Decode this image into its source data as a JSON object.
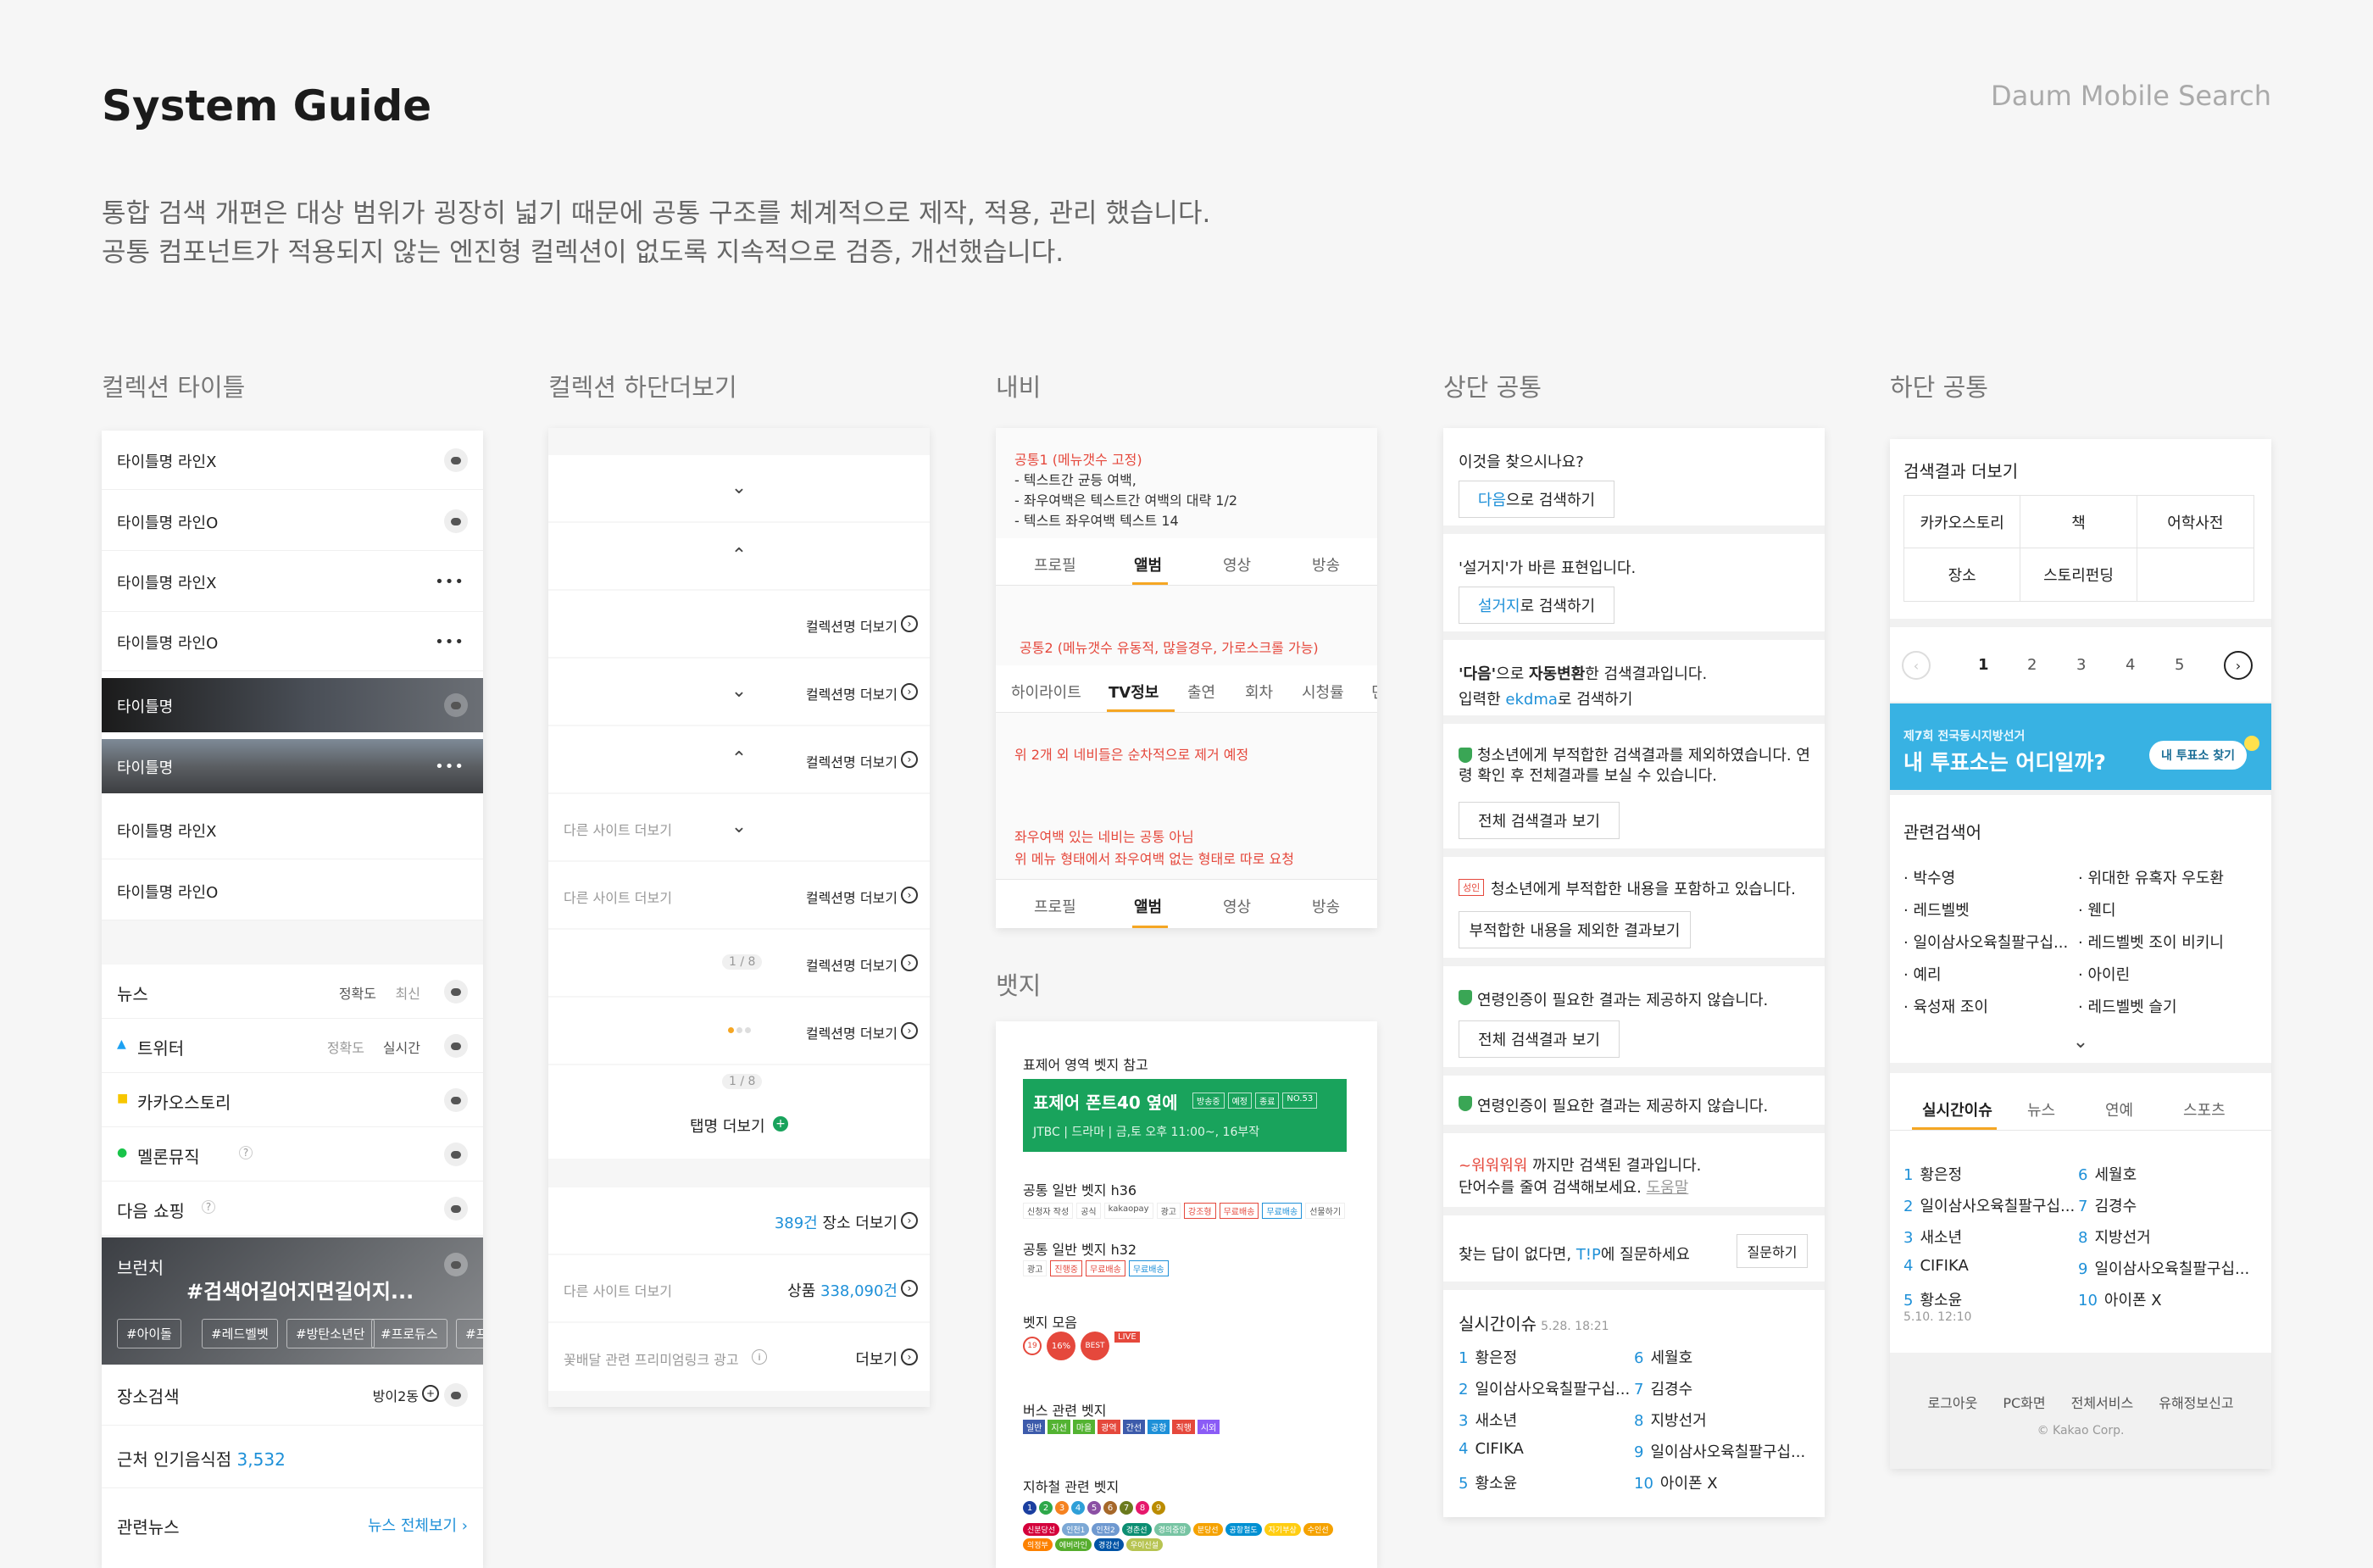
{
  "header": {
    "title": "System Guide",
    "brand": "Daum Mobile Search",
    "intro_line1": "통합 검색 개편은 대상 범위가 굉장히 넓기 때문에 공통 구조를 체계적으로 제작, 적용, 관리 했습니다.",
    "intro_line2": "공통 컴포넌트가 적용되지 않는 엔진형 컬렉션이 없도록 지속적으로 검증, 개선했습니다."
  },
  "columns": {
    "col1": "컬렉션 타이틀",
    "col2": "컬렉션 하단더보기",
    "col3": "내비",
    "col3b": "뱃지",
    "col4": "상단 공통",
    "col5": "하단 공통"
  },
  "col1": {
    "rows": [
      "타이틀명 라인X",
      "타이틀명 라인O",
      "타이틀명 라인X",
      "타이틀명 라인O",
      "타이틀명",
      "타이틀명",
      "타이틀명 라인X",
      "타이틀명 라인O"
    ],
    "news": "뉴스",
    "sort1": "정확도",
    "sort2": "최신",
    "twitter": "트위터",
    "tw_sort1": "정확도",
    "tw_sort2": "실시간",
    "kakaostory": "카카오스토리",
    "melon": "멜론뮤직",
    "melon_help": "?",
    "shopping": "다음 쇼핑",
    "shopping_help": "?",
    "brunch": "브런치",
    "brunch_headline": "#검색어길어지면길어지...",
    "tags": [
      "#아이돌",
      "#레드벨벳",
      "#방탄소년단",
      "#프로듀스",
      "#프"
    ],
    "place": "장소검색",
    "place_loc": "방이2동",
    "food_label": "근처 인기음식점",
    "food_count": "3,532",
    "related_news": "관련뉴스",
    "news_all": "뉴스 전체보기"
  },
  "col2": {
    "more": "컬렉션명 더보기",
    "other_site": "다른 사이트 더보기",
    "page1": "1 / 8",
    "page2": "1 / 8",
    "tab_more": "탭명 더보기",
    "place_count": "389건",
    "place_more": "장소 더보기",
    "prod_label": "상품",
    "prod_count": "338,090건",
    "ad": "꽃배달 관련 프리미엄링크 광고",
    "ad_more": "더보기"
  },
  "col3": {
    "note1_title": "공통1 (메뉴갯수 고정)",
    "note1_l1": "- 텍스트간 균등 여백,",
    "note1_l2": "- 좌우여백은 텍스트간 여백의 대략 1/2",
    "note1_l3": "- 텍스트 좌우여백 텍스트 14",
    "tabs1": [
      "프로필",
      "앨범",
      "영상",
      "방송"
    ],
    "note2": "공통2 (메뉴갯수 유동적, 많을경우, 가로스크롤 가능)",
    "tabs2": [
      "하이라이트",
      "TV정보",
      "출연",
      "회차",
      "시청률",
      "던"
    ],
    "note3": "위 2개 외 네비들은 순차적으로 제거 예정",
    "note4_l1": "좌우여백 있는 네비는 공통 아님",
    "note4_l2": "위 메뉴 형태에서 좌우여백 없는 형태로 따로 요청",
    "tabs3": [
      "프로필",
      "앨범",
      "영상",
      "방송"
    ]
  },
  "badges": {
    "ref": "표제어 영역 벳지 참고",
    "head_title": "표제어 폰트40 옆에",
    "head_badges": [
      "방송중",
      "예정",
      "종료",
      "NO.53"
    ],
    "head_sub": "JTBC  |  드라마  |  금,토 오후 11:00~, 16부작",
    "h36": "공통 일반 벳지 h36",
    "h36_pills": [
      "신청자 작성",
      "공식",
      "kakaopay",
      "광고",
      "강조형",
      "무료배송",
      "무료배송",
      "선물하기"
    ],
    "h32": "공통 일반 벳지 h32",
    "h32_pills": [
      "광고",
      "진행중",
      "무료배송",
      "무료배송"
    ],
    "collection": "벳지 모음",
    "col_pills": [
      "19",
      "16%",
      "BEST",
      "LIVE"
    ],
    "bus": "버스 관련 벳지",
    "bus_pills": [
      "일반",
      "지선",
      "마을",
      "광역",
      "간선",
      "공항",
      "직행",
      "시외"
    ],
    "subway": "지하철 관련 벳지",
    "subway_nums": [
      "1",
      "2",
      "3",
      "4",
      "5",
      "6",
      "7",
      "8",
      "9"
    ],
    "subway_lines": [
      "신분당선",
      "인천1",
      "인천2",
      "경춘선",
      "경의중앙",
      "분당선",
      "공항철도",
      "자기부상",
      "수인선",
      "의정부",
      "에버라인",
      "경강선",
      "우이신설"
    ]
  },
  "col4": {
    "q1": "이것을 찾으시나요?",
    "q1_btn_kw": "다음",
    "q1_btn": "으로 검색하기",
    "q2": "'설거지'가 바른 표현입니다.",
    "q2_btn_kw": "설거지",
    "q2_btn": "로 검색하기",
    "q3_pre": "'다음'",
    "q3_mid": "으로 ",
    "q3_bold": "자동변환",
    "q3_post": "한 검색결과입니다.",
    "q3_l2_pre": "입력한 ",
    "q3_l2_kw": "ekdma",
    "q3_l2_post": "로 검색하기",
    "q4_l1": "청소년에게 부적합한 검색결과를 제외하였습니다. 연",
    "q4_l2": "령 확인 후 전체결과를 보실 수 있습니다.",
    "q4_btn": "전체 검색결과 보기",
    "q5_badge": "성인",
    "q5": "청소년에게 부적합한 내용을 포함하고 있습니다.",
    "q5_btn": "부적합한 내용을 제외한 결과보기",
    "q6": "연령인증이 필요한 결과는 제공하지 않습니다.",
    "q6_btn": "전체 검색결과 보기",
    "q7": "연령인증이 필요한 결과는 제공하지 않습니다.",
    "q8_kw": "~워워워워",
    "q8_l1": " 까지만 검색된 결과입니다.",
    "q8_l2": "단어수를 줄여 검색해보세요.",
    "q8_help": "도움말",
    "q9_pre": "찾는 답이 없다면, ",
    "q9_kw": "T!P",
    "q9_post": "에 질문하세요",
    "q9_btn": "질문하기",
    "rt_title": "실시간이슈",
    "rt_time": "5.28. 18:21",
    "rt_left": [
      [
        "1",
        "황은정"
      ],
      [
        "2",
        "일이삼사오육칠팔구십..."
      ],
      [
        "3",
        "새소년"
      ],
      [
        "4",
        "CIFIKA"
      ],
      [
        "5",
        "황소윤"
      ]
    ],
    "rt_right": [
      [
        "6",
        "세월호"
      ],
      [
        "7",
        "김경수"
      ],
      [
        "8",
        "지방선거"
      ],
      [
        "9",
        "일이삼사오육칠팔구십..."
      ],
      [
        "10",
        "아이폰 X"
      ]
    ]
  },
  "col5": {
    "more_title": "검색결과 더보기",
    "grid": [
      "카카오스토리",
      "책",
      "어학사전",
      "장소",
      "스토리펀딩",
      ""
    ],
    "pages": [
      "1",
      "2",
      "3",
      "4",
      "5"
    ],
    "banner_small": "제7회 전국동시지방선거",
    "banner_big": "내 투표소는 어디일까?",
    "banner_btn": "내 투표소 찾기",
    "related": "관련검색어",
    "rel_left": [
      "박수영",
      "레드벨벳",
      "일이삼사오육칠팔구십...",
      "예리",
      "육성재 조이"
    ],
    "rel_right": [
      "위대한 유혹자 우도환",
      "웬디",
      "레드벨벳 조이 비키니",
      "아이린",
      "레드벨벳 슬기"
    ],
    "tabs": [
      "실시간이슈",
      "뉴스",
      "연예",
      "스포츠"
    ],
    "rt_left": [
      [
        "1",
        "황은정"
      ],
      [
        "2",
        "일이삼사오육칠팔구십..."
      ],
      [
        "3",
        "새소년"
      ],
      [
        "4",
        "CIFIKA"
      ],
      [
        "5",
        "황소윤"
      ]
    ],
    "rt_right": [
      [
        "6",
        "세월호"
      ],
      [
        "7",
        "김경수"
      ],
      [
        "8",
        "지방선거"
      ],
      [
        "9",
        "일이삼사오육칠팔구십..."
      ],
      [
        "10",
        "아이폰 X"
      ]
    ],
    "rt_time": "5.10. 12:10",
    "footer": [
      "로그아웃",
      "PC화면",
      "전체서비스",
      "유해정보신고"
    ],
    "copyright": "© Kakao Corp."
  },
  "colors": {
    "accent": "#1e90d8",
    "red": "#e5483c",
    "green": "#19a35c",
    "banner": "#38b2e3",
    "tab_active": "#f5a623"
  }
}
